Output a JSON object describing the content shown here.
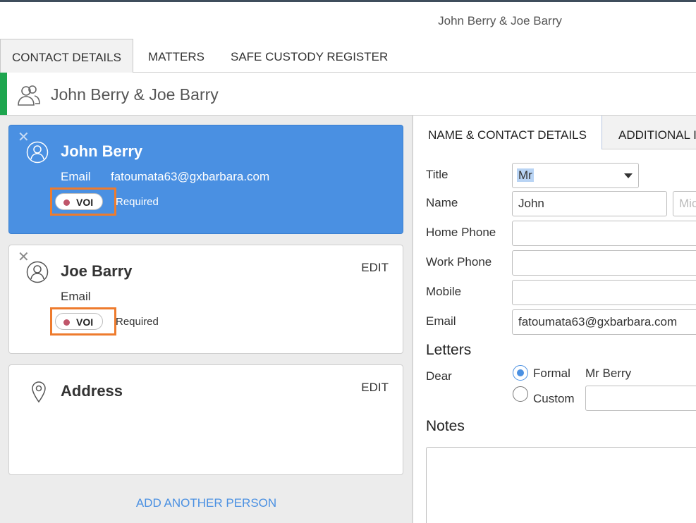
{
  "window": {
    "title": "John Berry & Joe Barry"
  },
  "tabs": [
    {
      "label": "CONTACT DETAILS"
    },
    {
      "label": "MATTERS"
    },
    {
      "label": "SAFE CUSTODY REGISTER"
    }
  ],
  "header": {
    "title": "John Berry & Joe Barry",
    "accent_color": "#1ea64f"
  },
  "people": [
    {
      "name": "John Berry",
      "email_label": "Email",
      "email": "fatoumata63@gxbarbara.com",
      "voi_label": "VOI",
      "voi_status": "Required",
      "selected": true
    },
    {
      "name": "Joe Barry",
      "email_label": "Email",
      "email": "",
      "voi_label": "VOI",
      "voi_status": "Required",
      "edit_label": "EDIT",
      "selected": false
    }
  ],
  "address": {
    "title": "Address",
    "edit_label": "EDIT"
  },
  "add_person_label": "ADD ANOTHER PERSON",
  "detail_tabs": [
    {
      "label": "NAME & CONTACT DETAILS"
    },
    {
      "label": "ADDITIONAL I"
    }
  ],
  "form": {
    "title_label": "Title",
    "title_value": "Mr",
    "name_label": "Name",
    "first_name": "John",
    "middle_placeholder": "Mic",
    "home_phone_label": "Home Phone",
    "home_phone": "",
    "work_phone_label": "Work Phone",
    "work_phone": "",
    "mobile_label": "Mobile",
    "mobile": "",
    "email_label": "Email",
    "email": "fatoumata63@gxbarbara.com"
  },
  "letters": {
    "heading": "Letters",
    "dear_label": "Dear",
    "formal_label": "Formal",
    "formal_value": "Mr Berry",
    "custom_label": "Custom",
    "custom_value": ""
  },
  "notes": {
    "heading": "Notes",
    "value": ""
  },
  "colors": {
    "selected_card": "#4a90e2",
    "highlight": "#ee7b2d",
    "voi_dot": "#c0566a",
    "link": "#4a90e2"
  }
}
